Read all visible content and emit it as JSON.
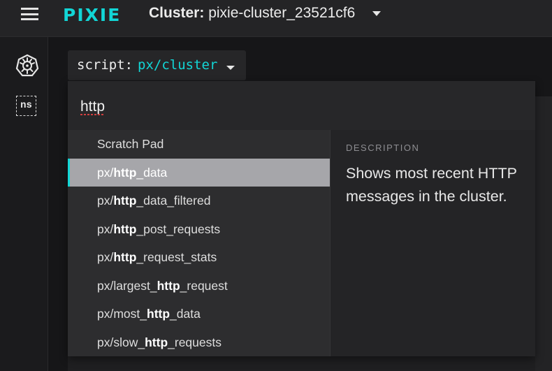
{
  "header": {
    "logo": "PIXIE",
    "cluster_label": "Cluster:",
    "cluster_value": " pixie-cluster_23521cf6",
    "icons": [
      "menu-icon",
      "chevron-down-icon"
    ]
  },
  "sidebar": {
    "items": [
      {
        "name": "kubernetes-icon"
      },
      {
        "name": "namespace-icon",
        "label": "ns"
      }
    ]
  },
  "script_selector": {
    "label": "script:",
    "value": "px/cluster"
  },
  "palette": {
    "search_value": "http",
    "items": [
      {
        "pre": "Scratch Pad",
        "match": "",
        "post": "",
        "active": false
      },
      {
        "pre": "px/",
        "match": "http",
        "post": "_data",
        "active": true
      },
      {
        "pre": "px/",
        "match": "http",
        "post": "_data_filtered",
        "active": false
      },
      {
        "pre": "px/",
        "match": "http",
        "post": "_post_requests",
        "active": false
      },
      {
        "pre": "px/",
        "match": "http",
        "post": "_request_stats",
        "active": false
      },
      {
        "pre": "px/largest_",
        "match": "http",
        "post": "_request",
        "active": false
      },
      {
        "pre": "px/most_",
        "match": "http",
        "post": "_data",
        "active": false
      },
      {
        "pre": "px/slow_",
        "match": "http",
        "post": "_requests",
        "active": false
      }
    ],
    "description_label": "DESCRIPTION",
    "description_text": "Shows most recent HTTP messages in the cluster."
  },
  "colors": {
    "accent": "#12d6d6",
    "highlight": "#a6a6aa"
  }
}
